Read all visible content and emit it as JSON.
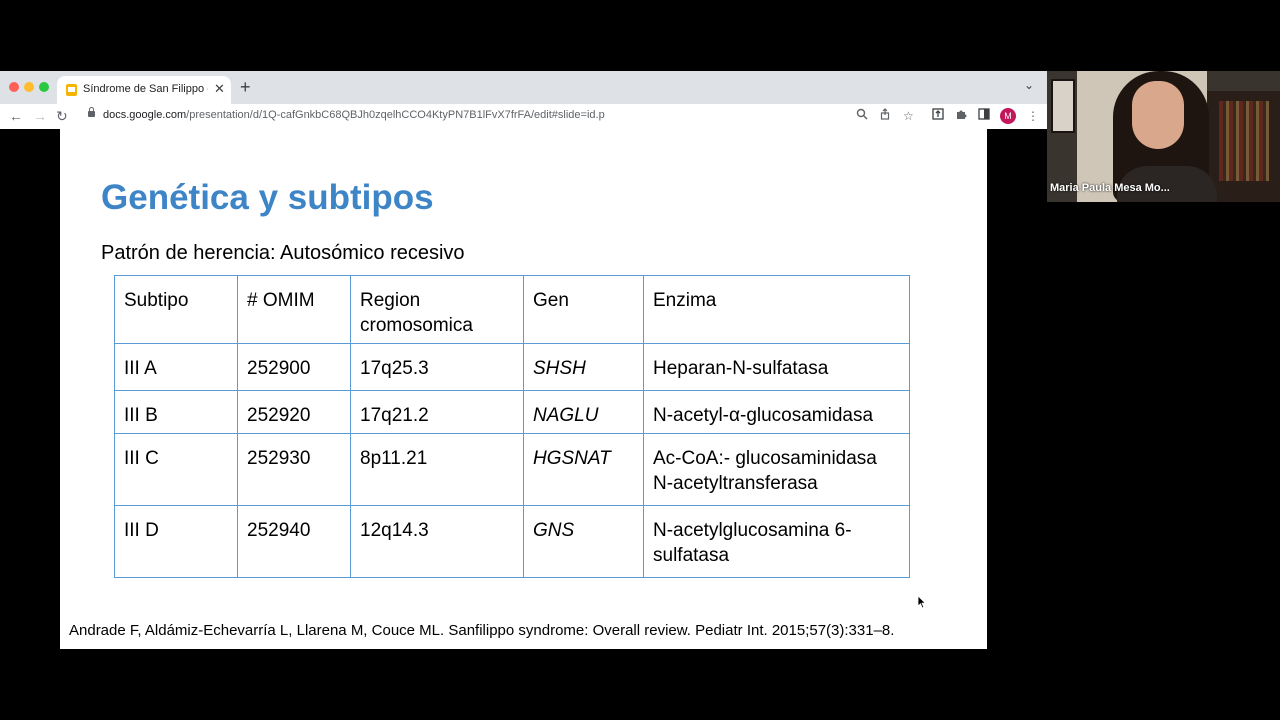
{
  "browser": {
    "tab_title": "Síndrome de San Filippo - Google Slides",
    "tab_close": "✕",
    "new_tab": "+",
    "url_host": "docs.google.com",
    "url_path": "/presentation/d/1Q-cafGnkbC68QBJh0zqelhCCO4KtyPN7B1lFvX7frFA/edit#slide=id.p",
    "avatar_letter": "M"
  },
  "slide": {
    "title": "Genética y subtipos",
    "subtitle": "Patrón de herencia: Autosómico recesivo",
    "table": {
      "headers": [
        "Subtipo",
        "# OMIM",
        "Region cromosomica",
        "Gen",
        "Enzima"
      ],
      "rows": [
        [
          "III A",
          "252900",
          "17q25.3",
          "SHSH",
          "Heparan-N-sulfatasa"
        ],
        [
          "III B",
          "252920",
          "17q21.2",
          "NAGLU",
          "N-acetyl-α-glucosamidasa"
        ],
        [
          "III C",
          "252930",
          "8p11.21",
          "HGSNAT",
          "Ac-CoA:- glucosaminidasa N-acetyltransferasa"
        ],
        [
          "III D",
          "252940",
          "12q14.3",
          "GNS",
          "N-acetylglucosamina 6-sulfatasa"
        ]
      ]
    },
    "citation": "Andrade F, Aldámiz-Echevarría L, Llarena M, Couce ML. Sanfilippo syndrome: Overall review. Pediatr Int. 2015;57(3):331–8."
  },
  "video": {
    "participant_name": "Maria Paula Mesa Mo..."
  },
  "colors": {
    "title_blue": "#3d85c6",
    "table_border": "#5b9bd5"
  }
}
